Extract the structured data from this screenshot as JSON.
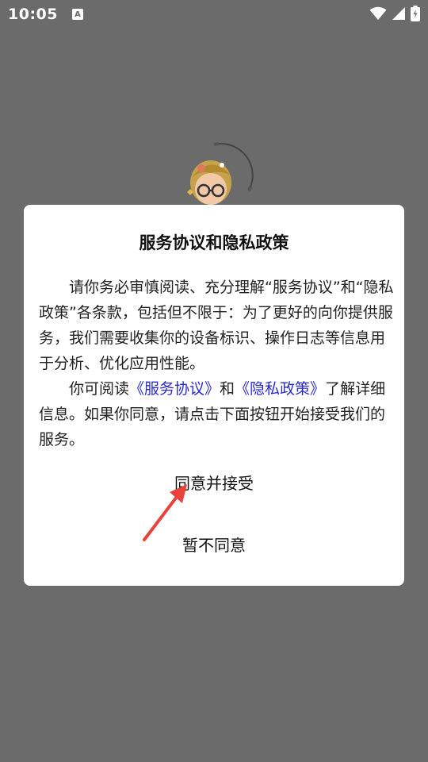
{
  "status_bar": {
    "time": "10:05",
    "notification_icon_glyph": "A",
    "icons": [
      "wifi-icon",
      "signal-icon",
      "battery-icon"
    ]
  },
  "dialog": {
    "title": "服务协议和隐私政策",
    "para1": "请你务必审慎阅读、充分理解“服务协议”和“隐私政策”各条款，包括但不限于：为了更好的向你提供服务，我们需要收集你的设备标识、操作日志等信息用于分析、优化应用性能。",
    "para2_prefix": "你可阅读",
    "service_link": "《服务协议》",
    "para2_and": "和",
    "privacy_link": "《隐私政策》",
    "para2_suffix": "了解详细信息。如果你同意，请点击下面按钮开始接受我们的服务。",
    "agree_label": "同意并接受",
    "decline_label": "暂不同意"
  },
  "colors": {
    "backdrop": "#6b6b6b",
    "link": "#2a2ad0",
    "annotation_arrow": "#e8423a"
  }
}
